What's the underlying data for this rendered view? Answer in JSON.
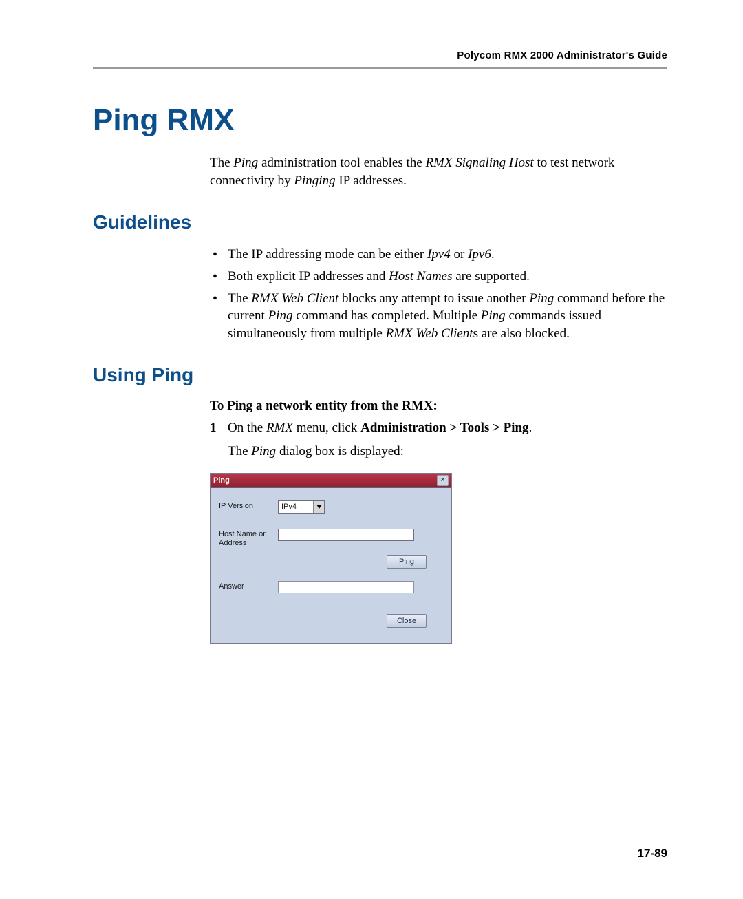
{
  "running_head": "Polycom RMX 2000 Administrator's Guide",
  "h1": "Ping RMX",
  "intro_parts": {
    "t1": "The ",
    "i1": "Ping",
    "t2": " administration tool enables the ",
    "i2": "RMX Signaling Host",
    "t3": " to test network connectivity by ",
    "i3": "Pinging",
    "t4": " IP addresses."
  },
  "h2_guidelines": "Guidelines",
  "bullets": {
    "b1": {
      "t1": "The IP addressing mode can be either ",
      "i1": "Ipv4",
      "t2": " or ",
      "i2": "Ipv6",
      "t3": "."
    },
    "b2": {
      "t1": "Both explicit IP addresses and ",
      "i1": "Host Names",
      "t2": " are supported."
    },
    "b3": {
      "t1": "The ",
      "i1": "RMX Web Client",
      "t2": " blocks any attempt to issue another ",
      "i2": "Ping",
      "t3": " command before the current ",
      "i3": "Ping",
      "t4": " command has completed. Multiple ",
      "i4": "Ping",
      "t5": " commands issued simultaneously from multiple ",
      "i5": "RMX Web Client",
      "t6": "s are also blocked."
    }
  },
  "h2_using": "Using Ping",
  "instr_head": "To Ping a network entity from the RMX:",
  "step1": {
    "num": "1",
    "t1": "On the ",
    "i1": "RMX",
    "t2": " menu, click ",
    "b1": "Administration > Tools > Ping",
    "t3": ".",
    "after_t1": "The ",
    "after_i1": "Ping",
    "after_t2": " dialog box is displayed:"
  },
  "dialog": {
    "title": "Ping",
    "close_x": "×",
    "labels": {
      "ip_version": "IP Version",
      "host": "Host Name or Address",
      "answer": "Answer"
    },
    "ip_version_value": "IPv4",
    "host_value": "",
    "answer_value": "",
    "buttons": {
      "ping": "Ping",
      "close": "Close"
    }
  },
  "folio": "17-89"
}
